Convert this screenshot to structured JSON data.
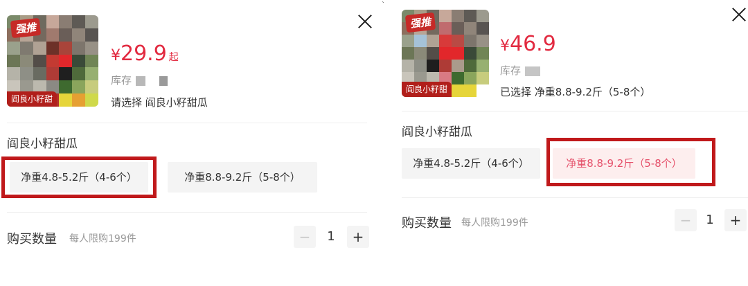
{
  "left": {
    "thumb_tag": "强推",
    "thumb_caption": "阎良小籽甜",
    "price_currency": "¥",
    "price_value": "29.9",
    "price_suffix": "起",
    "stock_label": "库存",
    "selection_text": "请选择 阎良小籽甜瓜",
    "section_title": "阎良小籽甜瓜",
    "options": [
      {
        "label": "净重4.8-5.2斤（4-6个）",
        "selected": false
      },
      {
        "label": "净重8.8-9.2斤（5-8个）",
        "selected": false
      }
    ],
    "highlighted_option": 0,
    "qty_label": "购买数量",
    "qty_limit": "每人限购199件",
    "qty_minus": "−",
    "qty_value": "1",
    "qty_plus": "+"
  },
  "right": {
    "thumb_tag": "强推",
    "thumb_caption": "阎良小籽甜",
    "price_currency": "¥",
    "price_value": "46.9",
    "stock_label": "库存",
    "selection_text": "已选择 净重8.8-9.2斤（5-8个）",
    "section_title": "阎良小籽甜瓜",
    "options": [
      {
        "label": "净重4.8-5.2斤（4-6个）",
        "selected": false
      },
      {
        "label": "净重8.8-9.2斤（5-8个）",
        "selected": true
      }
    ],
    "highlighted_option": 1,
    "qty_label": "购买数量",
    "qty_limit": "每人限购199件",
    "qty_minus": "−",
    "qty_value": "1",
    "qty_plus": "+"
  },
  "colors": {
    "price": "#e22a40",
    "highlight_box": "#c0191b",
    "selected_option_bg": "#fdeeee",
    "selected_option_text": "#e5506a",
    "option_bg": "#f4f4f4"
  },
  "icons": {
    "close": "close-icon",
    "minus": "minus-icon",
    "plus": "plus-icon"
  }
}
